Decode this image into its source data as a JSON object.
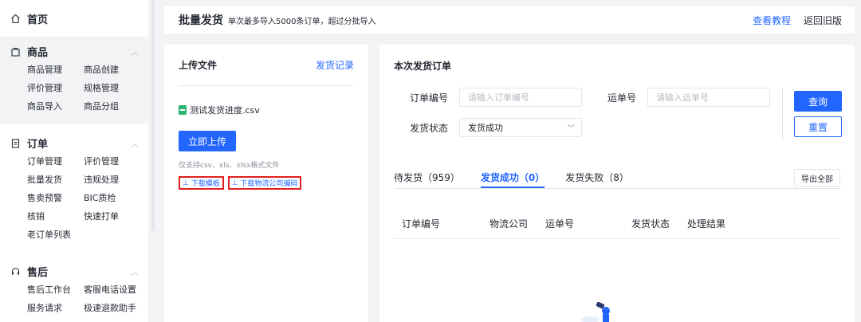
{
  "sidebar": {
    "home": "首页",
    "groups": [
      {
        "title": "商品",
        "items": [
          "商品管理",
          "商品创建",
          "评价管理",
          "规格管理",
          "商品导入",
          "商品分组"
        ]
      },
      {
        "title": "订单",
        "items": [
          "订单管理",
          "评价管理",
          "批量发货",
          "违规处理",
          "售卖预警",
          "BIC质检",
          "核销",
          "快速打单",
          "老订单列表"
        ]
      },
      {
        "title": "售后",
        "items": [
          "售后工作台",
          "客服电话设置",
          "服务请求",
          "极速退款助手"
        ]
      }
    ]
  },
  "header": {
    "title": "批量发货",
    "subtitle": "单次最多导入5000条订单，超过分批导入",
    "tutorial": "查看教程",
    "back": "返回旧版"
  },
  "upload": {
    "title": "上传文件",
    "history": "发货记录",
    "file_name": "测试发货进度.csv",
    "upload_button": "立即上传",
    "hint": "仅支持csv、xls、xlsx格式文件",
    "download_template": "下载模板",
    "download_codes": "下载物流公司编码"
  },
  "orders": {
    "title": "本次发货订单",
    "order_no_label": "订单编号",
    "order_no_placeholder": "请输入订单编号",
    "waybill_label": "运单号",
    "waybill_placeholder": "请输入运单号",
    "status_label": "发货状态",
    "status_value": "发货成功",
    "query_button": "查询",
    "reset_button": "重置",
    "tabs": [
      "待发货（959）",
      "发货成功（0）",
      "发货失败（8）"
    ],
    "export_button": "导出全部",
    "columns": [
      "订单编号",
      "物流公司",
      "运单号",
      "发货状态",
      "处理结果"
    ]
  },
  "colors": {
    "accent": "#2266ff",
    "highlight_border": "#e02020",
    "file_icon": "#2bb673"
  }
}
